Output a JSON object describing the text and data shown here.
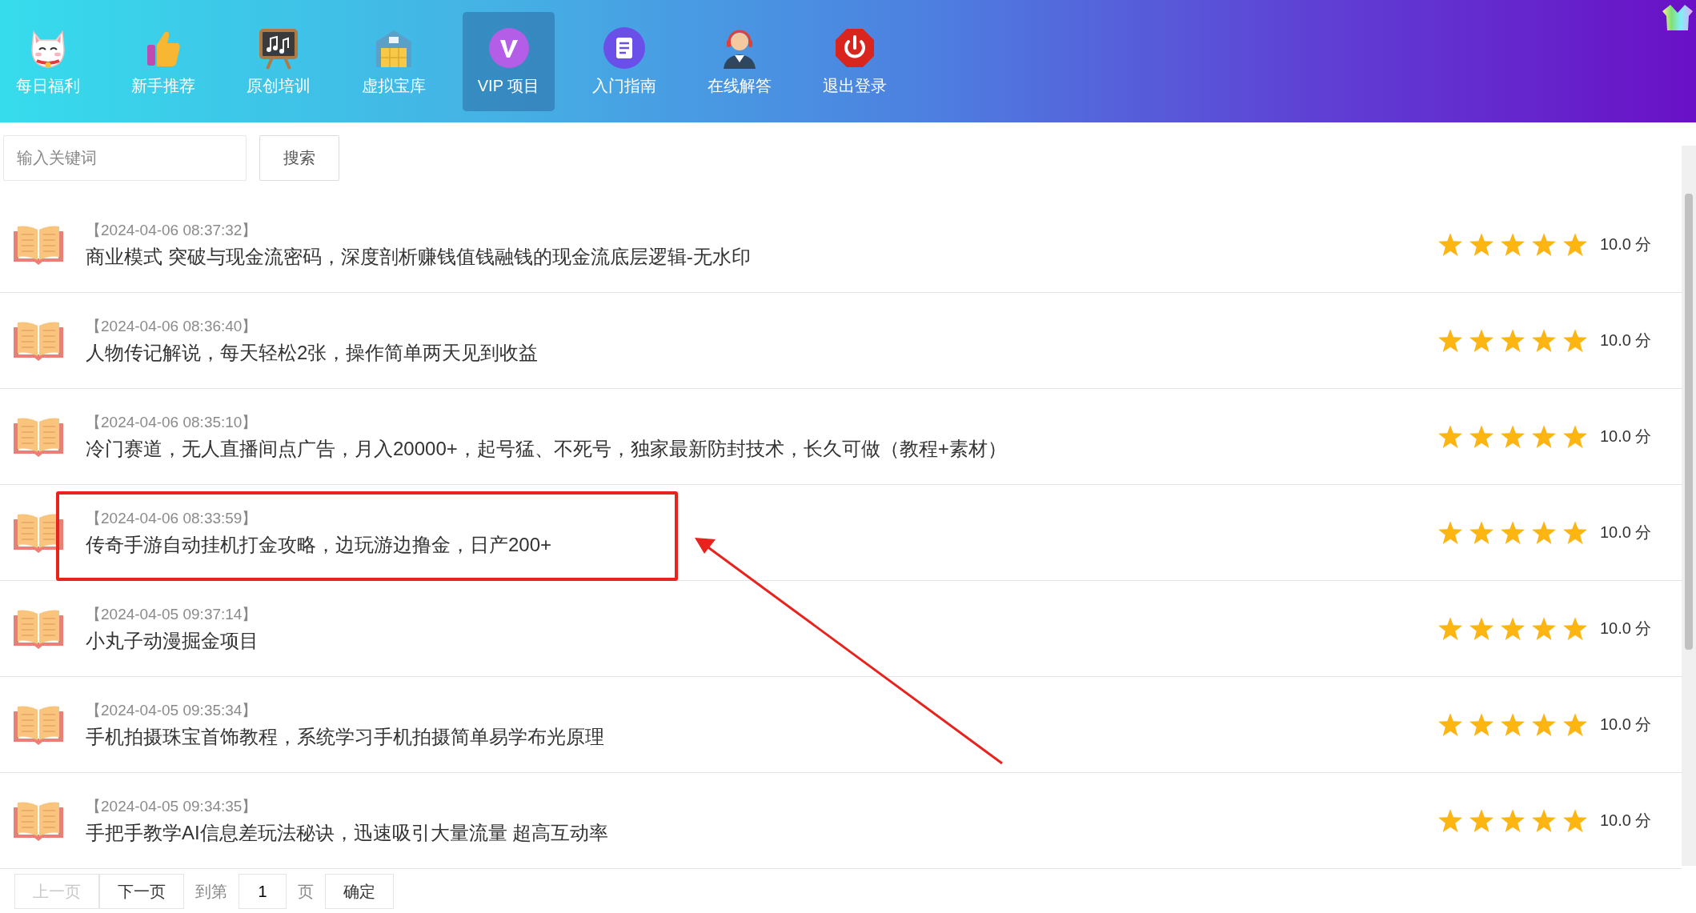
{
  "nav": [
    {
      "label": "每日福利",
      "selected": false
    },
    {
      "label": "新手推荐",
      "selected": false
    },
    {
      "label": "原创培训",
      "selected": false
    },
    {
      "label": "虚拟宝库",
      "selected": false
    },
    {
      "label": "VIP 项目",
      "selected": true
    },
    {
      "label": "入门指南",
      "selected": false
    },
    {
      "label": "在线解答",
      "selected": false
    },
    {
      "label": "退出登录",
      "selected": false
    }
  ],
  "search": {
    "placeholder": "输入关键词",
    "button": "搜索"
  },
  "items": [
    {
      "time": "【2024-04-06 08:37:32】",
      "title": "商业模式 突破与现金流密码，深度剖析赚钱值钱融钱的现金流底层逻辑-无水印",
      "stars": 5,
      "score": "10.0 分",
      "annotated": false
    },
    {
      "time": "【2024-04-06 08:36:40】",
      "title": "人物传记解说，每天轻松2张，操作简单两天见到收益",
      "stars": 5,
      "score": "10.0 分",
      "annotated": false
    },
    {
      "time": "【2024-04-06 08:35:10】",
      "title": "冷门赛道，无人直播间点广告，月入20000+，起号猛、不死号，独家最新防封技术，长久可做（教程+素材）",
      "stars": 5,
      "score": "10.0 分",
      "annotated": false
    },
    {
      "time": "【2024-04-06 08:33:59】",
      "title": "传奇手游自动挂机打金攻略，边玩游边撸金，日产200+",
      "stars": 5,
      "score": "10.0 分",
      "annotated": true
    },
    {
      "time": "【2024-04-05 09:37:14】",
      "title": "小丸子动漫掘金项目",
      "stars": 5,
      "score": "10.0 分",
      "annotated": false
    },
    {
      "time": "【2024-04-05 09:35:34】",
      "title": "手机拍摄珠宝首饰教程，系统学习手机拍摄简单易学布光原理",
      "stars": 5,
      "score": "10.0 分",
      "annotated": false
    },
    {
      "time": "【2024-04-05 09:34:35】",
      "title": "手把手教学AI信息差玩法秘诀，迅速吸引大量流量 超高互动率",
      "stars": 5,
      "score": "10.0 分",
      "annotated": false
    }
  ],
  "pagination": {
    "prev": {
      "label": "上一页",
      "disabled": true
    },
    "next": {
      "label": "下一页",
      "disabled": false
    },
    "goto_label": "到第",
    "page": "1",
    "page_unit": "页",
    "confirm": "确定"
  }
}
